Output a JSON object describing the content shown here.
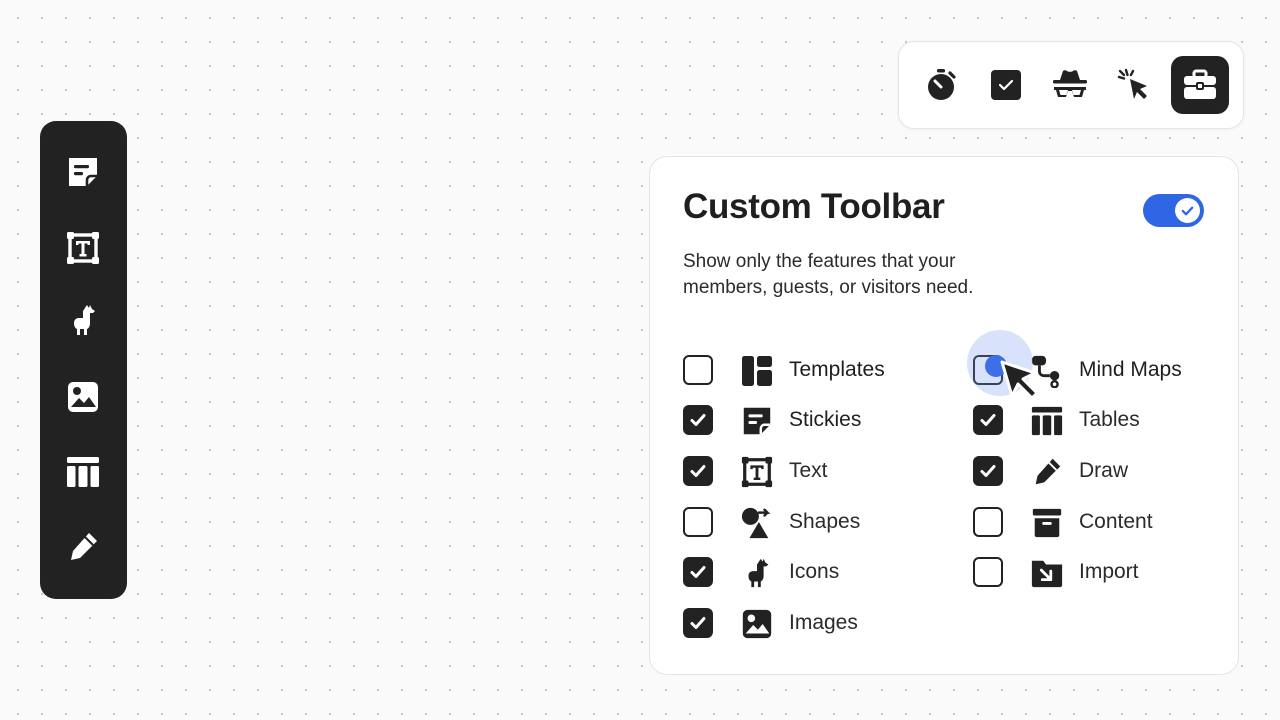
{
  "side_toolbar": {
    "items": [
      {
        "name": "stickies",
        "icon": "sticky-note-icon"
      },
      {
        "name": "text",
        "icon": "text-box-icon"
      },
      {
        "name": "icons",
        "icon": "llama-icon"
      },
      {
        "name": "images",
        "icon": "image-icon"
      },
      {
        "name": "tables",
        "icon": "table-icon"
      },
      {
        "name": "draw",
        "icon": "pencil-icon"
      }
    ]
  },
  "top_toolbar": {
    "items": [
      {
        "name": "timer",
        "icon": "stopwatch-icon"
      },
      {
        "name": "voting",
        "icon": "checkbox-icon"
      },
      {
        "name": "private-mode",
        "icon": "incognito-icon"
      },
      {
        "name": "attention",
        "icon": "cursor-click-icon"
      },
      {
        "name": "toolbox",
        "icon": "toolbox-icon",
        "active": true
      }
    ]
  },
  "panel": {
    "title": "Custom Toolbar",
    "toggle_on": true,
    "description_line1": "Show only the features that your",
    "description_line2": "members, guests, or visitors need.",
    "left_options": [
      {
        "label": "Templates",
        "checked": false,
        "icon": "templates-icon"
      },
      {
        "label": "Stickies",
        "checked": true,
        "icon": "sticky-note-icon"
      },
      {
        "label": "Text",
        "checked": true,
        "icon": "text-box-icon"
      },
      {
        "label": "Shapes",
        "checked": false,
        "icon": "shapes-icon"
      },
      {
        "label": "Icons",
        "checked": true,
        "icon": "llama-icon"
      },
      {
        "label": "Images",
        "checked": true,
        "icon": "image-icon"
      }
    ],
    "right_options": [
      {
        "label": "Mind Maps",
        "checked": false,
        "icon": "mind-map-icon"
      },
      {
        "label": "Tables",
        "checked": true,
        "icon": "table-icon"
      },
      {
        "label": "Draw",
        "checked": true,
        "icon": "pencil-icon"
      },
      {
        "label": "Content",
        "checked": false,
        "icon": "content-icon"
      },
      {
        "label": "Import",
        "checked": false,
        "icon": "import-folder-icon"
      }
    ]
  },
  "colors": {
    "accent": "#2f66e6",
    "dark": "#222222"
  }
}
